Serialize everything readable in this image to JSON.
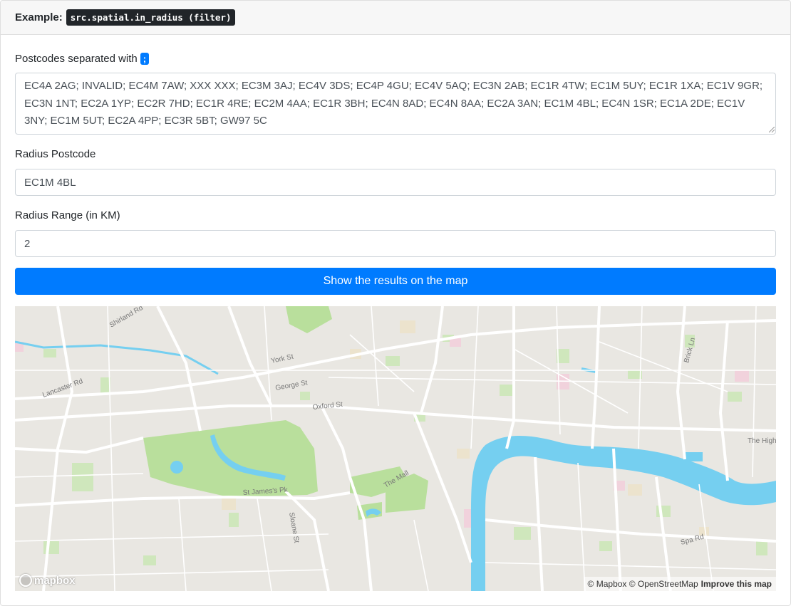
{
  "header": {
    "label": "Example:",
    "code": "src.spatial.in_radius (filter)"
  },
  "postcodes": {
    "label": "Postcodes separated with",
    "separator": ";",
    "value": "EC4A 2AG; INVALID; EC4M 7AW; XXX XXX; EC3M 3AJ; EC4V 3DS; EC4P 4GU; EC4V 5AQ; EC3N 2AB; EC1R 4TW; EC1M 5UY; EC1R 1XA; EC1V 9GR; EC3N 1NT; EC2A 1YP; EC2R 7HD; EC1R 4RE; EC2M 4AA; EC1R 3BH; EC4N 8AD; EC4N 8AA; EC2A 3AN; EC1M 4BL; EC4N 1SR; EC1A 2DE; EC1V 3NY; EC1M 5UT; EC2A 4PP; EC3R 5BT; GW97 5C"
  },
  "radius_postcode": {
    "label": "Radius Postcode",
    "value": "EC1M 4BL"
  },
  "radius_range": {
    "label": "Radius Range (in KM)",
    "value": "2"
  },
  "submit": {
    "label": "Show the results on the map"
  },
  "map": {
    "logo": "mapbox",
    "attribution": "© Mapbox © OpenStreetMap",
    "improve": "Improve this map",
    "street_labels": {
      "york_st": "York St",
      "george_st": "George St",
      "oxford_st": "Oxford St",
      "lancaster_rd": "Lancaster Rd",
      "the_mall": "The Mall",
      "st_jamess": "St James's Pk",
      "sloane_st": "Sloane St",
      "brick_ln": "Brick Ln",
      "spa_rd": "Spa Rd",
      "shirland_rd": "Shirland Rd",
      "the_highway": "The High"
    },
    "colors": {
      "land": "#e9e7e2",
      "park": "#b9df9c",
      "water": "#75cff0",
      "road": "#ffffff"
    }
  },
  "colors": {
    "primary": "#007bff",
    "code_bg": "#212529"
  }
}
